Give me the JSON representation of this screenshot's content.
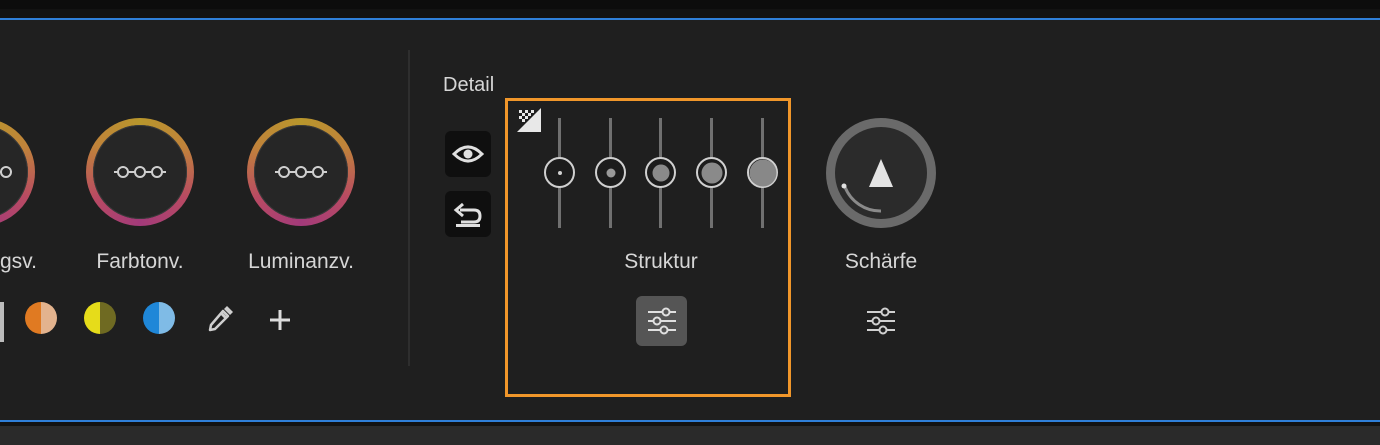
{
  "color_mixer": {
    "wheels": [
      {
        "label": "gsv."
      },
      {
        "label": "Farbtonv."
      },
      {
        "label": "Luminanzv."
      }
    ],
    "swatches": [
      {
        "name": "orange",
        "left": "#e07a22",
        "right": "#e3b38e"
      },
      {
        "name": "yellow",
        "left": "#e6dc1a",
        "right": "#6f6a22"
      },
      {
        "name": "blue",
        "left": "#1f87d8",
        "right": "#7fbbe6"
      }
    ],
    "eyedropper_icon": "eyedropper-icon",
    "add_icon": "+"
  },
  "detail": {
    "title": "Detail",
    "view_icon": "eye-icon",
    "reset_icon": "undo-icon",
    "struktur": {
      "label": "Struktur",
      "levels": 5,
      "selected_level": 2
    },
    "schaerfe": {
      "label": "Schärfe"
    }
  },
  "colors": {
    "accent_highlight": "#f0962a",
    "panel_border": "#2f7fd8"
  }
}
